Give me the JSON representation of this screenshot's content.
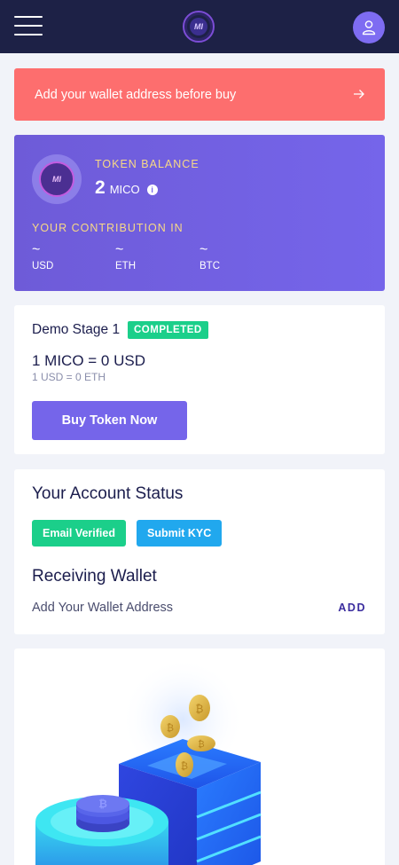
{
  "header": {
    "menu_icon": "hamburger-icon",
    "logo_text": "MI",
    "user_icon": "user-icon"
  },
  "alert": {
    "text": "Add your wallet address before buy",
    "icon": "arrow-right-icon",
    "color": "#fd6e6e"
  },
  "balance": {
    "label": "TOKEN BALANCE",
    "value": "2",
    "unit": "MICO",
    "token_logo_text": "MI",
    "contribution_label": "YOUR CONTRIBUTION IN",
    "contributions": [
      {
        "value": "~",
        "currency": "USD"
      },
      {
        "value": "~",
        "currency": "ETH"
      },
      {
        "value": "~",
        "currency": "BTC"
      }
    ]
  },
  "stage": {
    "title": "Demo Stage 1",
    "badge": "COMPLETED",
    "price": "1 MICO = 0 USD",
    "rate": "1 USD = 0 ETH",
    "buy_button": "Buy Token Now"
  },
  "account": {
    "title": "Your Account Status",
    "email_button": "Email Verified",
    "kyc_button": "Submit KYC",
    "wallet_title": "Receiving Wallet",
    "wallet_text": "Add Your Wallet Address",
    "wallet_add": "ADD"
  },
  "colors": {
    "topbar": "#1d2146",
    "accent": "#7565ea",
    "success": "#1bcf8a",
    "info": "#21a8ee",
    "gold": "#f8d986"
  }
}
